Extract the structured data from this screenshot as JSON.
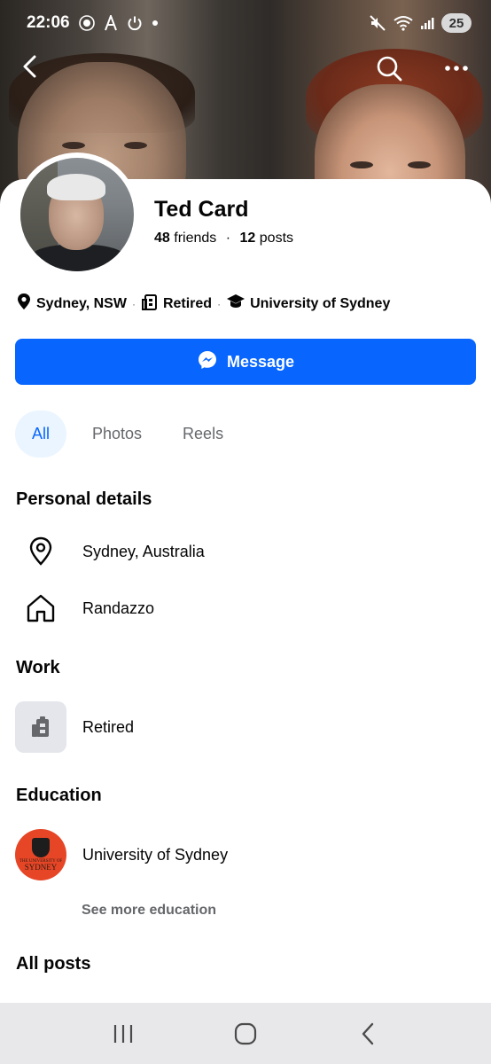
{
  "status_bar": {
    "time": "22:06",
    "battery_level": "25",
    "icons": [
      "manchester-united-icon",
      "font-a-icon",
      "power-icon",
      "dot-icon",
      "mute-icon",
      "wifi-icon",
      "signal-icon"
    ]
  },
  "cover_nav": {
    "icons": [
      "back-arrow-icon",
      "search-icon",
      "more-dots-icon"
    ]
  },
  "profile": {
    "name": "Ted Card",
    "friends_count": "48",
    "friends_label": "friends",
    "posts_count": "12",
    "posts_label": "posts",
    "intro": {
      "location": "Sydney, NSW",
      "work": "Retired",
      "education": "University of Sydney"
    }
  },
  "message_button": {
    "label": "Message",
    "icon": "messenger-icon",
    "color": "#0866ff"
  },
  "tabs": [
    {
      "label": "All",
      "active": true
    },
    {
      "label": "Photos",
      "active": false
    },
    {
      "label": "Reels",
      "active": false
    }
  ],
  "personal_details": {
    "title": "Personal details",
    "items": [
      {
        "icon": "location-pin-icon",
        "text": "Sydney, Australia"
      },
      {
        "icon": "home-icon",
        "text": "Randazzo"
      }
    ]
  },
  "work": {
    "title": "Work",
    "items": [
      {
        "icon": "building-icon",
        "text": "Retired"
      }
    ]
  },
  "education": {
    "title": "Education",
    "items": [
      {
        "icon": "university-logo",
        "text": "University of Sydney",
        "logo_small": "THE UNIVERSITY OF",
        "logo_big": "SYDNEY"
      }
    ],
    "see_more": "See more education"
  },
  "all_posts": {
    "title": "All posts"
  },
  "nav_bar": {
    "icons": [
      "recent-apps-icon",
      "home-circle-icon",
      "back-chevron-icon"
    ]
  }
}
